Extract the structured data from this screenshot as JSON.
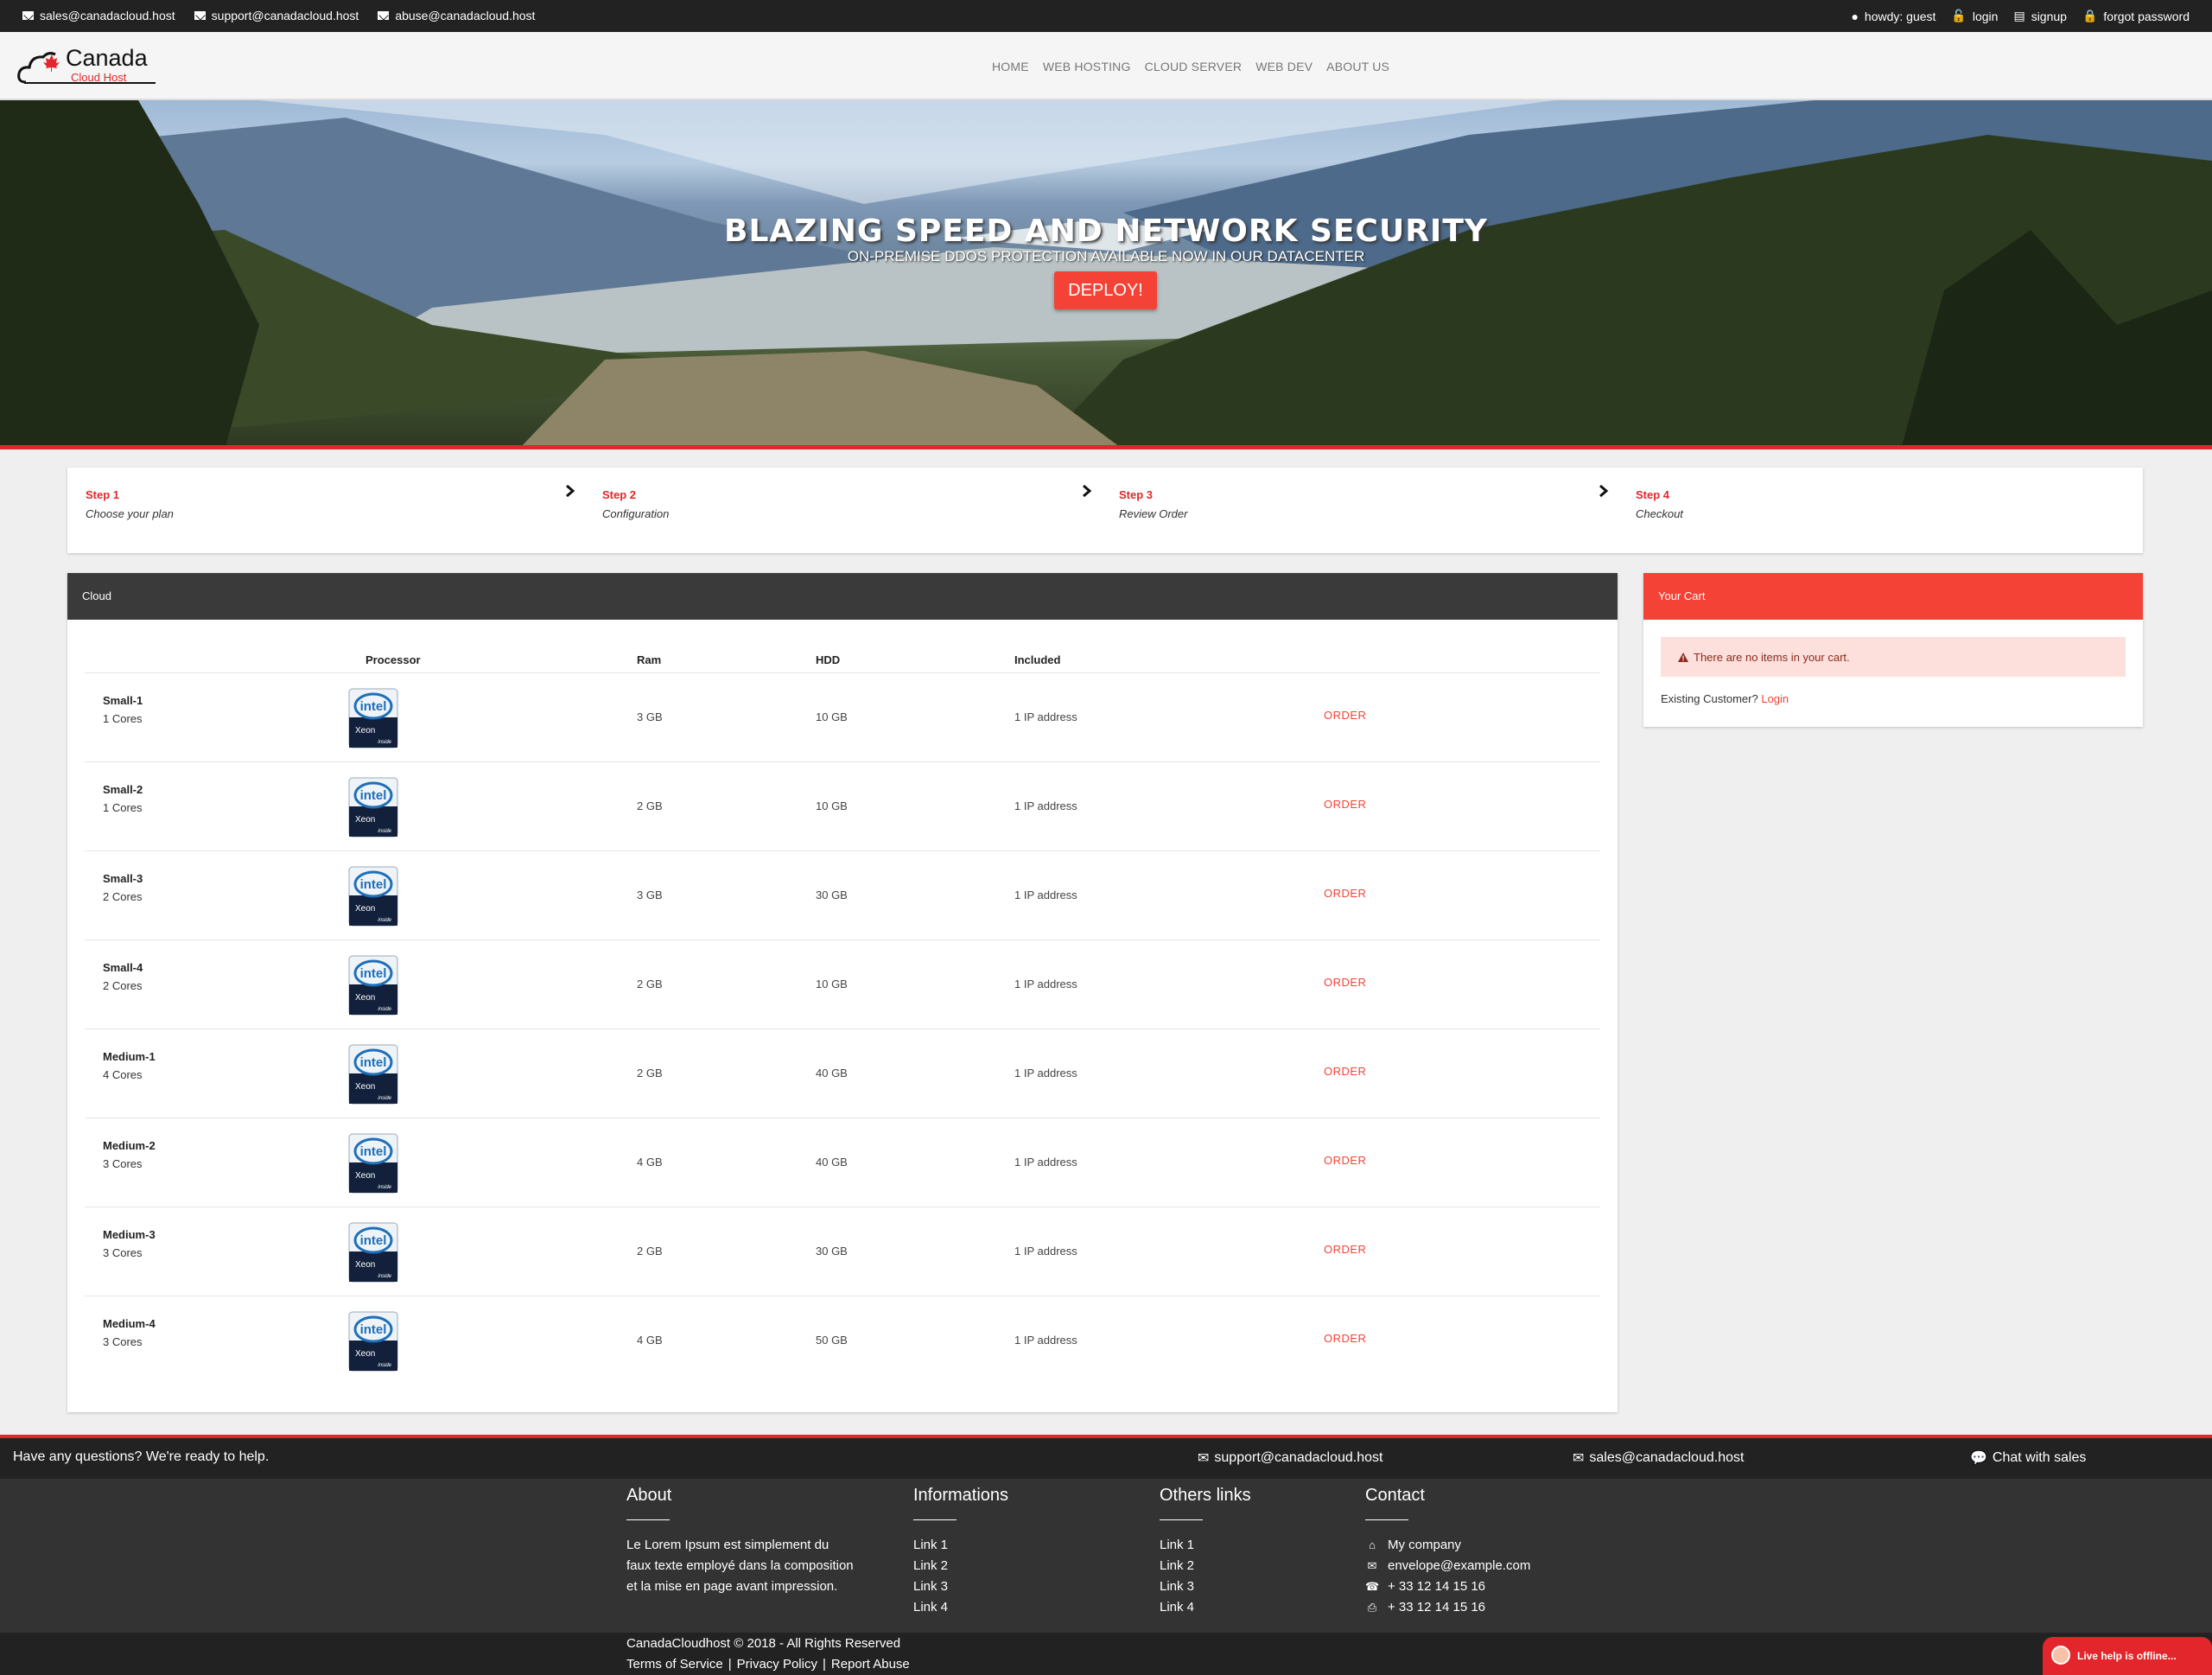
{
  "topbar": {
    "emails": [
      "sales@canadacloud.host",
      "support@canadacloud.host",
      "abuse@canadacloud.host"
    ],
    "user_links": {
      "howdy": "howdy: guest",
      "login": "login",
      "signup": "signup",
      "forgot": "forgot password"
    }
  },
  "header": {
    "logo_text": "Canada",
    "logo_sub": "Cloud Host",
    "nav": [
      "HOME",
      "WEB HOSTING",
      "CLOUD SERVER",
      "WEB DEV",
      "ABOUT US"
    ]
  },
  "hero": {
    "title": "BLAZING SPEED AND NETWORK SECURITY",
    "subtitle": "ON-PREMISE DDOS PROTECTION AVAILABLE NOW IN OUR DATACENTER",
    "button": "DEPLOY!"
  },
  "steps": [
    {
      "title": "Step 1",
      "sub": "Choose your plan"
    },
    {
      "title": "Step 2",
      "sub": "Configuration"
    },
    {
      "title": "Step 3",
      "sub": "Review Order"
    },
    {
      "title": "Step 4",
      "sub": "Checkout"
    }
  ],
  "cloud": {
    "heading": "Cloud",
    "columns": {
      "processor": "Processor",
      "ram": "Ram",
      "hdd": "HDD",
      "included": "Included"
    },
    "cpu_badge": {
      "brand": "intel",
      "model": "Xeon",
      "tag": "inside"
    },
    "plans": [
      {
        "name": "Small-1",
        "cores": "1 Cores",
        "ram": "3 GB",
        "hdd": "10 GB",
        "included": "1 IP address",
        "action": "ORDER"
      },
      {
        "name": "Small-2",
        "cores": "1 Cores",
        "ram": "2 GB",
        "hdd": "10 GB",
        "included": "1 IP address",
        "action": "ORDER"
      },
      {
        "name": "Small-3",
        "cores": "2 Cores",
        "ram": "3 GB",
        "hdd": "30 GB",
        "included": "1 IP address",
        "action": "ORDER"
      },
      {
        "name": "Small-4",
        "cores": "2 Cores",
        "ram": "2 GB",
        "hdd": "10 GB",
        "included": "1 IP address",
        "action": "ORDER"
      },
      {
        "name": "Medium-1",
        "cores": "4 Cores",
        "ram": "2 GB",
        "hdd": "40 GB",
        "included": "1 IP address",
        "action": "ORDER"
      },
      {
        "name": "Medium-2",
        "cores": "3 Cores",
        "ram": "4 GB",
        "hdd": "40 GB",
        "included": "1 IP address",
        "action": "ORDER"
      },
      {
        "name": "Medium-3",
        "cores": "3 Cores",
        "ram": "2 GB",
        "hdd": "30 GB",
        "included": "1 IP address",
        "action": "ORDER"
      },
      {
        "name": "Medium-4",
        "cores": "3 Cores",
        "ram": "4 GB",
        "hdd": "50 GB",
        "included": "1 IP address",
        "action": "ORDER"
      }
    ]
  },
  "cart": {
    "heading": "Your Cart",
    "empty": "There are no items in your cart.",
    "existing": "Existing Customer?",
    "login": "Login"
  },
  "footer": {
    "question": "Have any questions? We're ready to help.",
    "support": "support@canadacloud.host",
    "sales": "sales@canadacloud.host",
    "chat": "Chat with sales",
    "about": {
      "title": "About",
      "text": "Le Lorem Ipsum est simplement du faux texte employé dans la composition et la mise en page avant impression."
    },
    "informations": {
      "title": "Informations",
      "links": [
        "Link 1",
        "Link 2",
        "Link 3",
        "Link 4"
      ]
    },
    "others": {
      "title": "Others links",
      "links": [
        "Link 1",
        "Link 2",
        "Link 3",
        "Link 4"
      ]
    },
    "contact": {
      "title": "Contact",
      "company": "My company",
      "email": "envelope@example.com",
      "phone": "+ 33 12 14 15 16",
      "fax": "+ 33 12 14 15 16"
    },
    "copyright": "CanadaCloudhost © 2018 - All Rights Reserved",
    "legal": [
      "Terms of Service",
      "Privacy Policy",
      "Report Abuse"
    ],
    "live_help": "Live help is offline..."
  },
  "colors": {
    "accent": "#f44336",
    "brand_red": "#e3262b",
    "dark": "#222222",
    "panel_dark": "#3a3a3a"
  }
}
